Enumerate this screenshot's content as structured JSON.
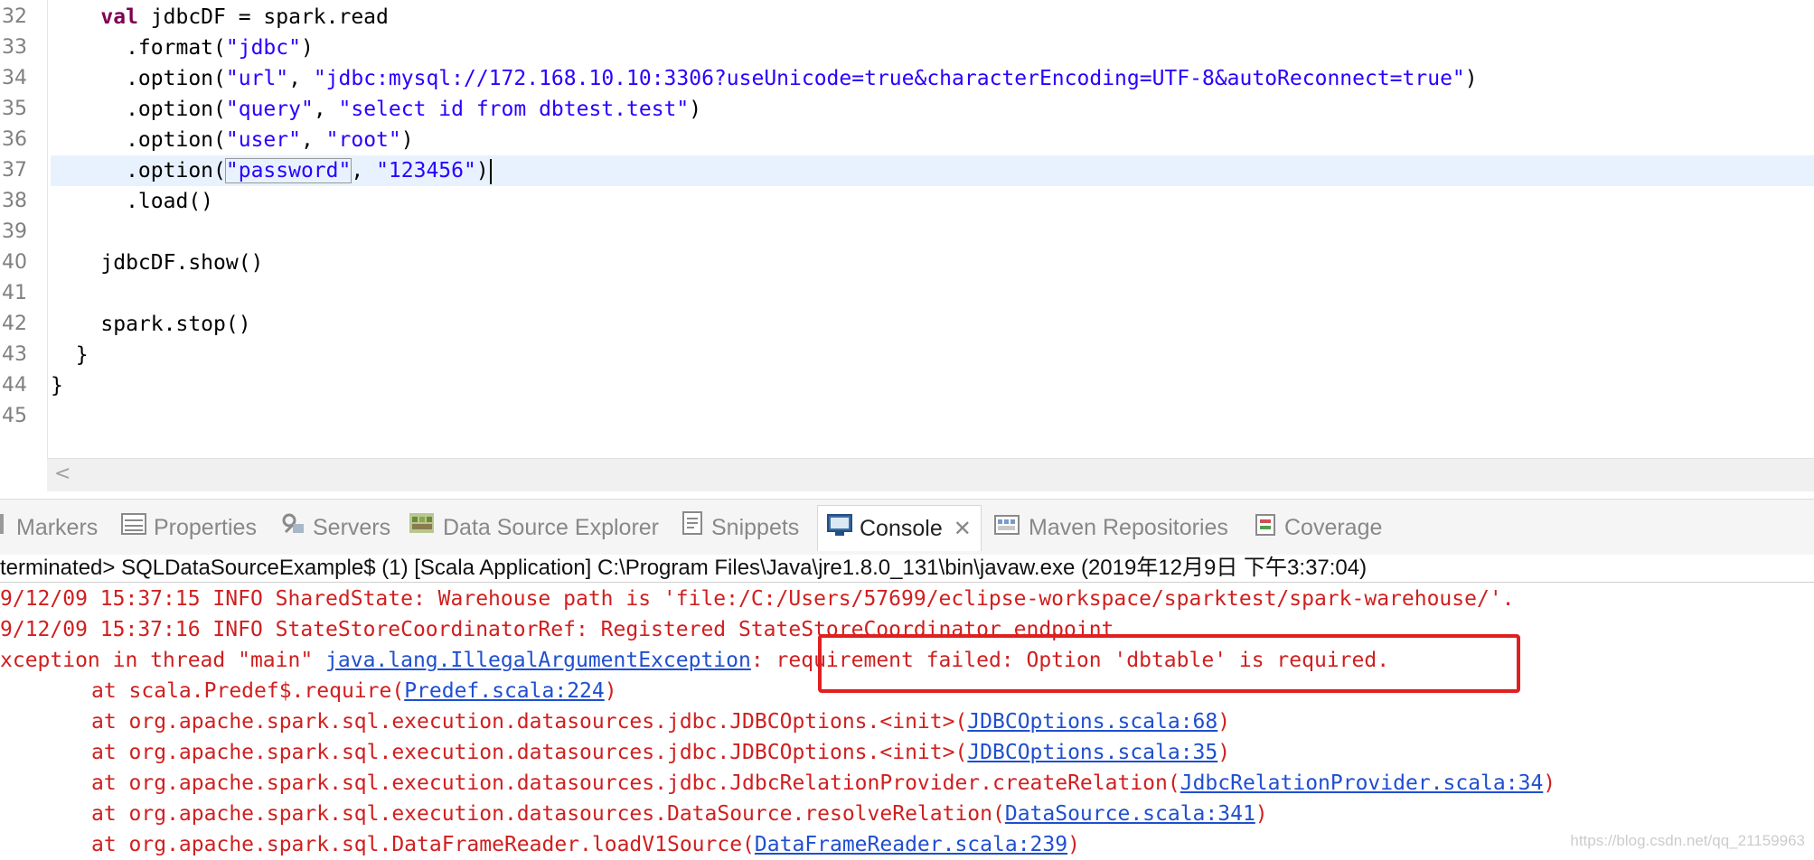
{
  "editor": {
    "lines": [
      {
        "num": "32",
        "text": "    val jdbcDF = spark.read"
      },
      {
        "num": "33",
        "text": "      .format(\"jdbc\")"
      },
      {
        "num": "34",
        "text": "      .option(\"url\", \"jdbc:mysql://172.168.10.10:3306?useUnicode=true&characterEncoding=UTF-8&autoReconnect=true\")"
      },
      {
        "num": "35",
        "text": "      .option(\"query\", \"select id from dbtest.test\")"
      },
      {
        "num": "36",
        "text": "      .option(\"user\", \"root\")"
      },
      {
        "num": "37",
        "text": "      .option(\"password\", \"123456\")"
      },
      {
        "num": "38",
        "text": "      .load()"
      },
      {
        "num": "39",
        "text": ""
      },
      {
        "num": "40",
        "text": "    jdbcDF.show()"
      },
      {
        "num": "41",
        "text": ""
      },
      {
        "num": "42",
        "text": "    spark.stop()"
      },
      {
        "num": "43",
        "text": "  }"
      },
      {
        "num": "44",
        "text": "}"
      },
      {
        "num": "45",
        "text": ""
      }
    ],
    "current_line": "37",
    "hscroll_arrow": "<"
  },
  "tabs": [
    {
      "label": "Markers",
      "icon": "markers-icon"
    },
    {
      "label": "Properties",
      "icon": "properties-icon"
    },
    {
      "label": "Servers",
      "icon": "servers-icon"
    },
    {
      "label": "Data Source Explorer",
      "icon": "data-source-explorer-icon"
    },
    {
      "label": "Snippets",
      "icon": "snippets-icon"
    },
    {
      "label": "Console",
      "icon": "console-icon",
      "active": true
    },
    {
      "label": "Maven Repositories",
      "icon": "maven-icon"
    },
    {
      "label": "Coverage",
      "icon": "coverage-icon"
    }
  ],
  "console": {
    "header": "terminated> SQLDataSourceExample$ (1) [Scala Application] C:\\Program Files\\Java\\jre1.8.0_131\\bin\\javaw.exe (2019年12月9日 下午3:37:04)",
    "lines": [
      {
        "pre": "9/12/09 15:37:15 INFO SharedState: Warehouse path is 'file:/C:/Users/57699/eclipse-workspace/sparktest/spark-warehouse/'.",
        "link": "",
        "post": ""
      },
      {
        "pre": "9/12/09 15:37:16 INFO StateStoreCoordinatorRef: Registered StateStoreCoordinator endpoint",
        "link": "",
        "post": ""
      },
      {
        "pre": "xception in thread \"main\" ",
        "link": "java.lang.IllegalArgumentException",
        "post": ": requirement failed: Option 'dbtable' is required."
      },
      {
        "pre": "\tat scala.Predef$.require(",
        "link": "Predef.scala:224",
        "post": ")"
      },
      {
        "pre": "\tat org.apache.spark.sql.execution.datasources.jdbc.JDBCOptions.<init>(",
        "link": "JDBCOptions.scala:68",
        "post": ")"
      },
      {
        "pre": "\tat org.apache.spark.sql.execution.datasources.jdbc.JDBCOptions.<init>(",
        "link": "JDBCOptions.scala:35",
        "post": ")"
      },
      {
        "pre": "\tat org.apache.spark.sql.execution.datasources.jdbc.JdbcRelationProvider.createRelation(",
        "link": "JdbcRelationProvider.scala:34",
        "post": ")"
      },
      {
        "pre": "\tat org.apache.spark.sql.execution.datasources.DataSource.resolveRelation(",
        "link": "DataSource.scala:341",
        "post": ")"
      },
      {
        "pre": "\tat org.apache.spark.sql.DataFrameReader.loadV1Source(",
        "link": "DataFrameReader.scala:239",
        "post": ")"
      }
    ]
  },
  "watermark": "https://blog.csdn.net/qq_21159963",
  "colors": {
    "keyword": "#7f0055",
    "string": "#2a00ff",
    "error": "#d01f1f",
    "link": "#1f4fd0",
    "highlight_box": "#e02020"
  }
}
